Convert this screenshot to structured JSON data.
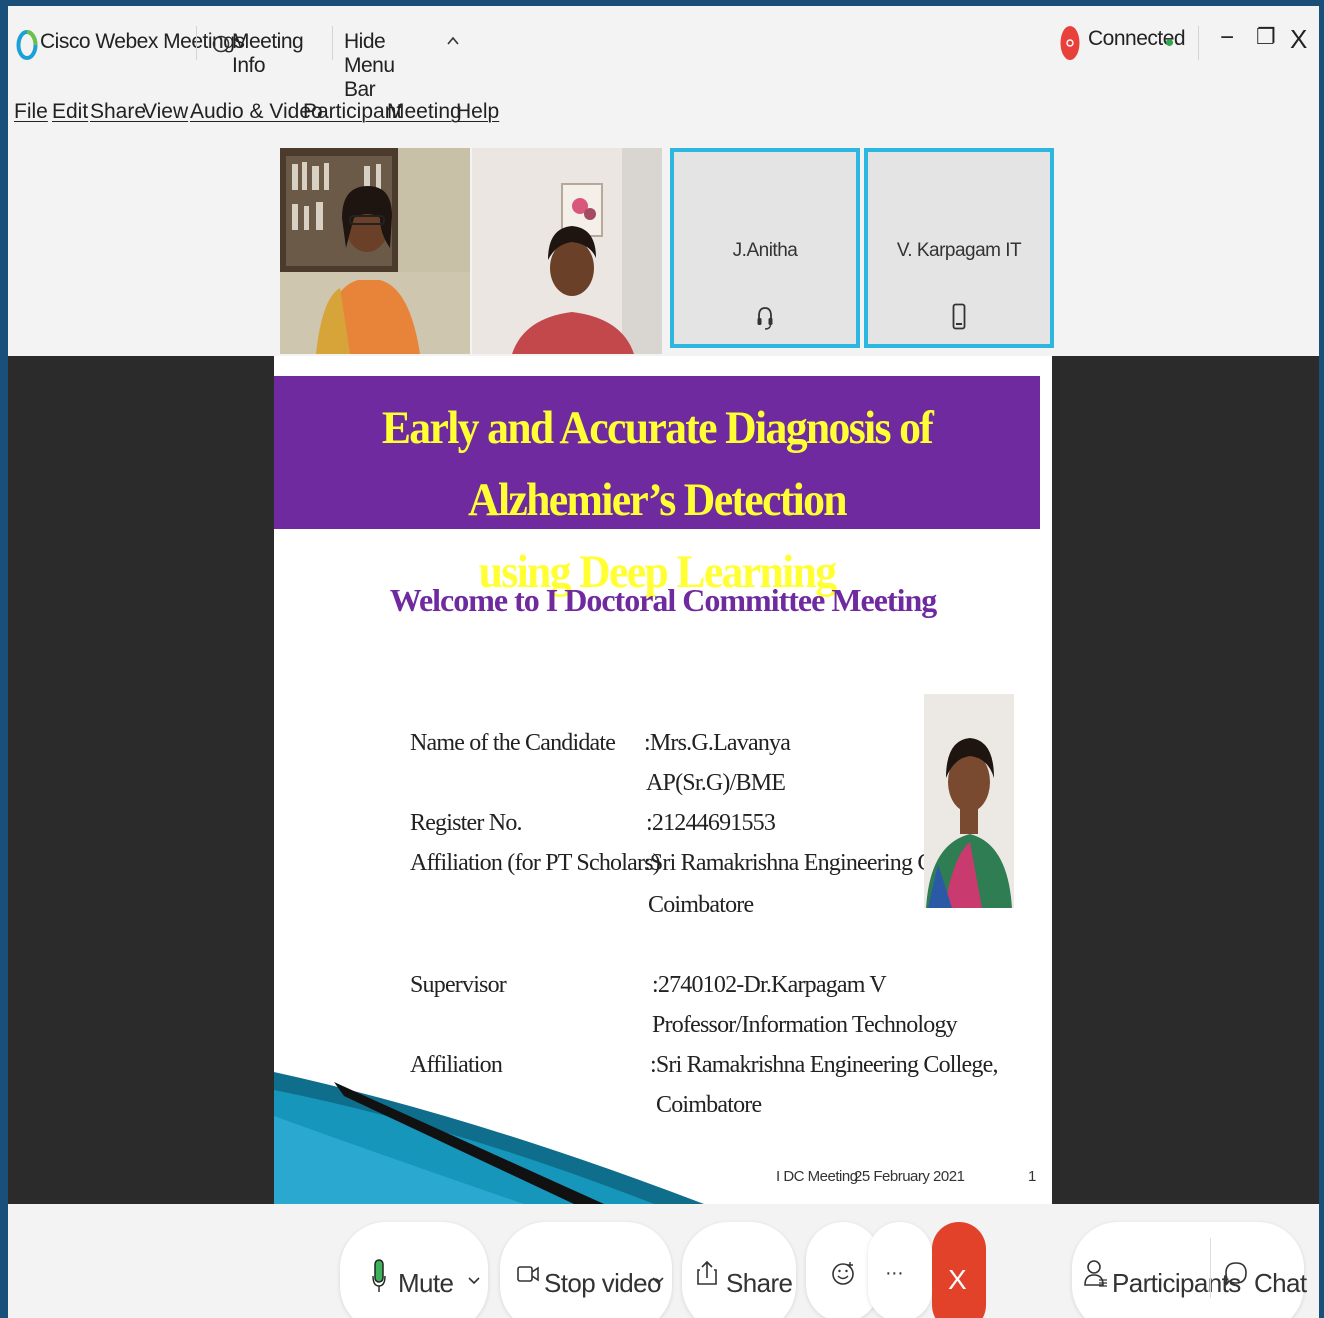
{
  "titlebar": {
    "app_name": "Cisco Webex Meetings",
    "meeting_info": "Meeting Info",
    "hide_menu_bar": "Hide Menu Bar",
    "status": "Connected",
    "status_color": "#2fa84f",
    "minimize_glyph": "−",
    "restore_glyph": "❐",
    "close_glyph": "X"
  },
  "menu": [
    "File",
    "Edit",
    "Share",
    "View",
    "Audio & Video",
    "Participant",
    "Meeting",
    "Help"
  ],
  "participants_strip": {
    "tiles": [
      {
        "name": "J.Anitha",
        "icon": "headset-icon"
      },
      {
        "name": "V. Karpagam IT",
        "icon": "phone-icon"
      }
    ],
    "active_border_color": "#2bb7e0"
  },
  "slide": {
    "title_line1": "Early and Accurate Diagnosis of Alzhemier’s Detection",
    "title_line2": "using Deep Learning",
    "welcome": "Welcome to I Doctoral Committee Meeting",
    "banner_color": "#6f2a9f",
    "title_color": "#ffff33",
    "rows": {
      "candidate_label": "Name of the Candidate",
      "candidate_value": ":Mrs.G.Lavanya",
      "designation": "AP(Sr.G)/BME",
      "register_label": "Register No.",
      "register_value": ":21244691553",
      "affiliation_pt_label": "Affiliation (for PT Scholars)",
      "affiliation_pt_value": ":Sri Ramakrishna Engineering College,",
      "affiliation_pt_city": "Coimbatore",
      "supervisor_label": "Supervisor",
      "supervisor_value": ":2740102-Dr.Karpagam V",
      "supervisor_title": "Professor/Information Technology",
      "affiliation_label": "Affiliation",
      "affiliation_value": ":Sri Ramakrishna Engineering College,",
      "affiliation_city": "Coimbatore"
    },
    "footer_meeting": "I DC Meeting",
    "footer_date": "25 February 2021",
    "footer_page": "1"
  },
  "toolbar": {
    "mute": "Mute",
    "stop_video": "Stop video",
    "share": "Share",
    "more": "···",
    "end_glyph": "X",
    "participants": "Participants",
    "chat": "Chat",
    "end_color": "#e2412a"
  }
}
